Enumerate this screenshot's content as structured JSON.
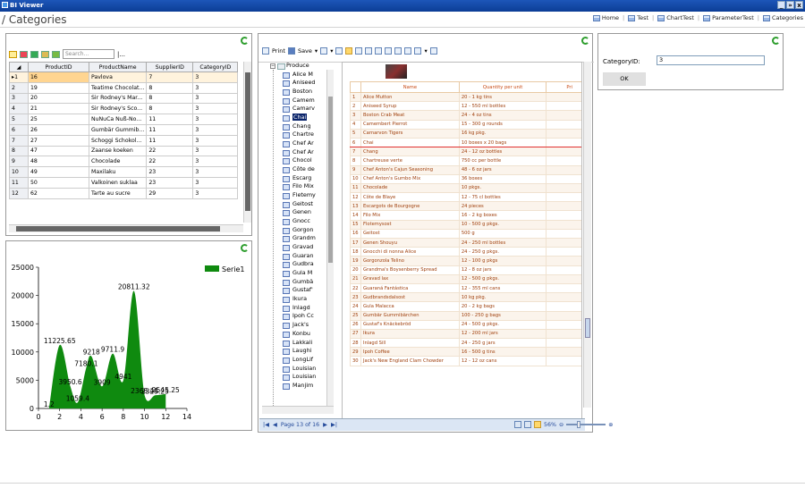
{
  "window": {
    "title": "BI Viewer",
    "min": "_",
    "max": "»",
    "close": "x"
  },
  "page": {
    "title": "/ Categories"
  },
  "nav": [
    {
      "label": "Home"
    },
    {
      "label": "Test"
    },
    {
      "label": "ChartTest"
    },
    {
      "label": "ParameterTest"
    },
    {
      "label": "Categories"
    }
  ],
  "grid": {
    "search_placeholder": "Search...",
    "search_more": "|...",
    "columns": [
      "ProductID",
      "ProductName",
      "SupplierID",
      "CategoryID"
    ],
    "rows": [
      {
        "n": "1",
        "id": "16",
        "name": "Pavlova",
        "sup": "7",
        "cat": "3"
      },
      {
        "n": "2",
        "id": "19",
        "name": "Teatime Chocolat...",
        "sup": "8",
        "cat": "3"
      },
      {
        "n": "3",
        "id": "20",
        "name": "Sir Rodney's Mar...",
        "sup": "8",
        "cat": "3"
      },
      {
        "n": "4",
        "id": "21",
        "name": "Sir Rodney's Sco...",
        "sup": "8",
        "cat": "3"
      },
      {
        "n": "5",
        "id": "25",
        "name": "NuNuCa Nuß-No...",
        "sup": "11",
        "cat": "3"
      },
      {
        "n": "6",
        "id": "26",
        "name": "Gumbär Gummib...",
        "sup": "11",
        "cat": "3"
      },
      {
        "n": "7",
        "id": "27",
        "name": "Schoggi Schokol...",
        "sup": "11",
        "cat": "3"
      },
      {
        "n": "8",
        "id": "47",
        "name": "Zaanse koeken",
        "sup": "22",
        "cat": "3"
      },
      {
        "n": "9",
        "id": "48",
        "name": "Chocolade",
        "sup": "22",
        "cat": "3"
      },
      {
        "n": "10",
        "id": "49",
        "name": "Maxilaku",
        "sup": "23",
        "cat": "3"
      },
      {
        "n": "11",
        "id": "50",
        "name": "Valkoinen suklaa",
        "sup": "23",
        "cat": "3"
      },
      {
        "n": "12",
        "id": "62",
        "name": "Tarte au sucre",
        "sup": "29",
        "cat": "3"
      }
    ]
  },
  "chart_data": {
    "type": "area",
    "legend": "Serie1",
    "xlim": [
      0,
      14
    ],
    "ylim": [
      0,
      25000
    ],
    "xticks": [
      "0",
      "2",
      "4",
      "6",
      "8",
      "10",
      "12",
      "14"
    ],
    "yticks": [
      "0",
      "5000",
      "10000",
      "15000",
      "20000",
      "25000"
    ],
    "points": [
      {
        "x": 1,
        "y": 1.2,
        "label": "1.2"
      },
      {
        "x": 2,
        "y": 11225.65,
        "label": "11225.65"
      },
      {
        "x": 3,
        "y": 3950.6,
        "label": "3950.6"
      },
      {
        "x": 3.7,
        "y": 1059.4,
        "label": "1059.4"
      },
      {
        "x": 4.5,
        "y": 7180.1,
        "label": "7180.1"
      },
      {
        "x": 5,
        "y": 9218,
        "label": "9218"
      },
      {
        "x": 6,
        "y": 3909,
        "label": "3909"
      },
      {
        "x": 7,
        "y": 9711.9,
        "label": "9711.9"
      },
      {
        "x": 8,
        "y": 4941,
        "label": "4941"
      },
      {
        "x": 9,
        "y": 20811.32,
        "label": "20811.32"
      },
      {
        "x": 10,
        "y": 2368.44,
        "label": "2368.44"
      },
      {
        "x": 11,
        "y": 2325.25,
        "label": "2325.25"
      },
      {
        "x": 12,
        "y": 2545.25,
        "label": "2545.25"
      }
    ]
  },
  "report": {
    "print": "Print",
    "save": "Save",
    "page_info": "Page 13 of 16",
    "zoom": "56%",
    "tree_root": "Produce",
    "tree_items": [
      "Alice M",
      "Aniseed",
      "Boston",
      "Camem",
      "Camarv",
      "Chai",
      "Chang",
      "Chartre",
      "Chef Ar",
      "Chef Ar",
      "Chocol",
      "Côte de",
      "Escarg",
      "Filo Mix",
      "Fletemy",
      "Geitost",
      "Genen",
      "Gnocc",
      "Gorgon",
      "Grandm",
      "Gravad",
      "Guaran",
      "Gudbra",
      "Gula M",
      "Gumbä",
      "Gustaf'",
      "Ikura",
      "Inlagd",
      "Ipoh Cc",
      "Jack's",
      "Konbu",
      "Lakkali",
      "Laughi",
      "LongLif",
      "Louisian",
      "Louisian",
      "Manjim"
    ],
    "col_name": "Name",
    "col_qty": "Quantity per unit",
    "col_price": "Pri",
    "rows": [
      {
        "n": "1",
        "name": "Alice Mutton",
        "qty": "20 - 1 kg tins"
      },
      {
        "n": "2",
        "name": "Aniseed Syrup",
        "qty": "12 - 550 ml bottles"
      },
      {
        "n": "3",
        "name": "Boston Crab Meat",
        "qty": "24 - 4 oz tins"
      },
      {
        "n": "4",
        "name": "Camembert Pierrot",
        "qty": "15 - 300 g rounds"
      },
      {
        "n": "5",
        "name": "Carnarvon Tigers",
        "qty": "16 kg pkg."
      },
      {
        "n": "6",
        "name": "Chai",
        "qty": "10 boxes x 20 bags"
      },
      {
        "n": "7",
        "name": "Chang",
        "qty": "24 - 12 oz bottles"
      },
      {
        "n": "8",
        "name": "Chartreuse verte",
        "qty": "750 cc per bottle"
      },
      {
        "n": "9",
        "name": "Chef Anton's Cajun Seasoning",
        "qty": "48 - 6 oz jars"
      },
      {
        "n": "10",
        "name": "Chef Anton's Gumbo Mix",
        "qty": "36 boxes"
      },
      {
        "n": "11",
        "name": "Chocolade",
        "qty": "10 pkgs."
      },
      {
        "n": "12",
        "name": "Côte de Blaye",
        "qty": "12 - 75 cl bottles"
      },
      {
        "n": "13",
        "name": "Escargots de Bourgogne",
        "qty": "24 pieces"
      },
      {
        "n": "14",
        "name": "Filo Mix",
        "qty": "16 - 2 kg boxes"
      },
      {
        "n": "15",
        "name": "Flotemysost",
        "qty": "10 - 500 g pkgs."
      },
      {
        "n": "16",
        "name": "Geitost",
        "qty": "500 g"
      },
      {
        "n": "17",
        "name": "Genen Shouyu",
        "qty": "24 - 250 ml bottles"
      },
      {
        "n": "18",
        "name": "Gnocchi di nonna Alice",
        "qty": "24 - 250 g pkgs."
      },
      {
        "n": "19",
        "name": "Gorgonzola Telino",
        "qty": "12 - 100 g pkgs"
      },
      {
        "n": "20",
        "name": "Grandma's Boysenberry Spread",
        "qty": "12 - 8 oz jars"
      },
      {
        "n": "21",
        "name": "Gravad lax",
        "qty": "12 - 500 g pkgs."
      },
      {
        "n": "22",
        "name": "Guaraná Fantástica",
        "qty": "12 - 355 ml cans"
      },
      {
        "n": "23",
        "name": "Gudbrandsdalsost",
        "qty": "10 kg pkg."
      },
      {
        "n": "24",
        "name": "Gula Malacca",
        "qty": "20 - 2 kg bags"
      },
      {
        "n": "25",
        "name": "Gumbär Gummibärchen",
        "qty": "100 - 250 g bags"
      },
      {
        "n": "26",
        "name": "Gustaf's Knäckebröd",
        "qty": "24 - 500 g pkgs."
      },
      {
        "n": "27",
        "name": "Ikura",
        "qty": "12 - 200 ml jars"
      },
      {
        "n": "28",
        "name": "Inlagd Sill",
        "qty": "24 - 250 g jars"
      },
      {
        "n": "29",
        "name": "Ipoh Coffee",
        "qty": "16 - 500 g tins"
      },
      {
        "n": "30",
        "name": "Jack's New England Clam Chowder",
        "qty": "12 - 12 oz cans"
      }
    ]
  },
  "param": {
    "label": "CategoryID:",
    "value": "3",
    "ok": "OK"
  }
}
